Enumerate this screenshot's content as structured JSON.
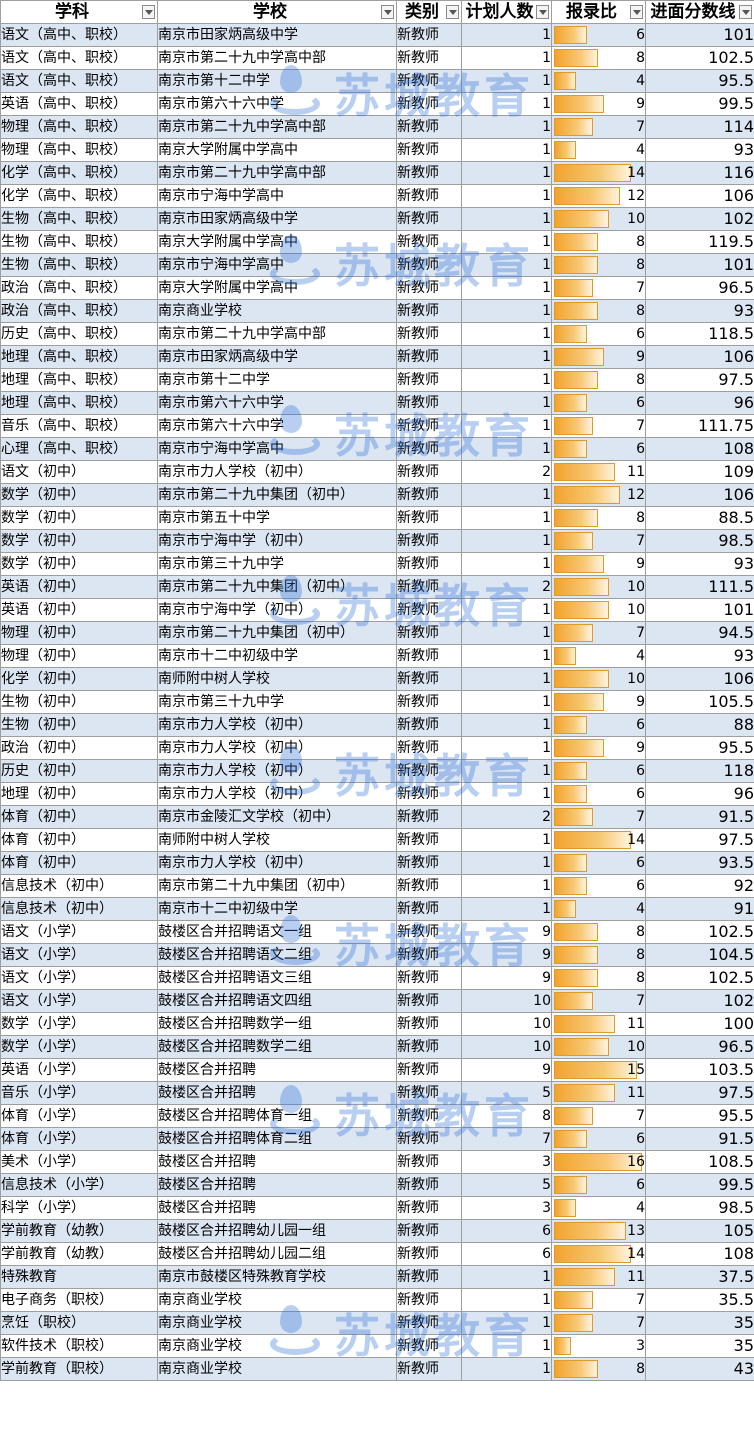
{
  "headers": {
    "subject": "学科",
    "school": "学校",
    "category": "类别",
    "plan": "计划人数",
    "ratio": "报录比",
    "score": "进面分数线"
  },
  "watermark": {
    "text": "苏城教育",
    "color": "#2a6fd6",
    "icon": "water-drop-logo-icon"
  },
  "ratio_max": 16,
  "rows": [
    [
      "语文（高中、职校）",
      "南京市田家炳高级中学",
      "新教师",
      "1",
      "6",
      "101"
    ],
    [
      "语文（高中、职校）",
      "南京市第二十九中学高中部",
      "新教师",
      "1",
      "8",
      "102.5"
    ],
    [
      "语文（高中、职校）",
      "南京市第十二中学",
      "新教师",
      "1",
      "4",
      "95.5"
    ],
    [
      "英语（高中、职校）",
      "南京市第六十六中学",
      "新教师",
      "1",
      "9",
      "99.5"
    ],
    [
      "物理（高中、职校）",
      "南京市第二十九中学高中部",
      "新教师",
      "1",
      "7",
      "114"
    ],
    [
      "物理（高中、职校）",
      "南京大学附属中学高中",
      "新教师",
      "1",
      "4",
      "93"
    ],
    [
      "化学（高中、职校）",
      "南京市第二十九中学高中部",
      "新教师",
      "1",
      "14",
      "116"
    ],
    [
      "化学（高中、职校）",
      "南京市宁海中学高中",
      "新教师",
      "1",
      "12",
      "106"
    ],
    [
      "生物（高中、职校）",
      "南京市田家炳高级中学",
      "新教师",
      "1",
      "10",
      "102"
    ],
    [
      "生物（高中、职校）",
      "南京大学附属中学高中",
      "新教师",
      "1",
      "8",
      "119.5"
    ],
    [
      "生物（高中、职校）",
      "南京市宁海中学高中",
      "新教师",
      "1",
      "8",
      "101"
    ],
    [
      "政治（高中、职校）",
      "南京大学附属中学高中",
      "新教师",
      "1",
      "7",
      "96.5"
    ],
    [
      "政治（高中、职校）",
      "南京商业学校",
      "新教师",
      "1",
      "8",
      "93"
    ],
    [
      "历史（高中、职校）",
      "南京市第二十九中学高中部",
      "新教师",
      "1",
      "6",
      "118.5"
    ],
    [
      "地理（高中、职校）",
      "南京市田家炳高级中学",
      "新教师",
      "1",
      "9",
      "106"
    ],
    [
      "地理（高中、职校）",
      "南京市第十二中学",
      "新教师",
      "1",
      "8",
      "97.5"
    ],
    [
      "地理（高中、职校）",
      "南京市第六十六中学",
      "新教师",
      "1",
      "6",
      "96"
    ],
    [
      "音乐（高中、职校）",
      "南京市第六十六中学",
      "新教师",
      "1",
      "7",
      "111.75"
    ],
    [
      "心理（高中、职校）",
      "南京市宁海中学高中",
      "新教师",
      "1",
      "6",
      "108"
    ],
    [
      "语文（初中）",
      "南京市力人学校（初中）",
      "新教师",
      "2",
      "11",
      "109"
    ],
    [
      "数学（初中）",
      "南京市第二十九中集团（初中）",
      "新教师",
      "1",
      "12",
      "106"
    ],
    [
      "数学（初中）",
      "南京市第五十中学",
      "新教师",
      "1",
      "8",
      "88.5"
    ],
    [
      "数学（初中）",
      "南京市宁海中学（初中）",
      "新教师",
      "1",
      "7",
      "98.5"
    ],
    [
      "数学（初中）",
      "南京市第三十九中学",
      "新教师",
      "1",
      "9",
      "93"
    ],
    [
      "英语（初中）",
      "南京市第二十九中集团（初中）",
      "新教师",
      "2",
      "10",
      "111.5"
    ],
    [
      "英语（初中）",
      "南京市宁海中学（初中）",
      "新教师",
      "1",
      "10",
      "101"
    ],
    [
      "物理（初中）",
      "南京市第二十九中集团（初中）",
      "新教师",
      "1",
      "7",
      "94.5"
    ],
    [
      "物理（初中）",
      "南京市十二中初级中学",
      "新教师",
      "1",
      "4",
      "93"
    ],
    [
      "化学（初中）",
      "南师附中树人学校",
      "新教师",
      "1",
      "10",
      "106"
    ],
    [
      "生物（初中）",
      "南京市第三十九中学",
      "新教师",
      "1",
      "9",
      "105.5"
    ],
    [
      "生物（初中）",
      "南京市力人学校（初中）",
      "新教师",
      "1",
      "6",
      "88"
    ],
    [
      "政治（初中）",
      "南京市力人学校（初中）",
      "新教师",
      "1",
      "9",
      "95.5"
    ],
    [
      "历史（初中）",
      "南京市力人学校（初中）",
      "新教师",
      "1",
      "6",
      "118"
    ],
    [
      "地理（初中）",
      "南京市力人学校（初中）",
      "新教师",
      "1",
      "6",
      "96"
    ],
    [
      "体育（初中）",
      "南京市金陵汇文学校（初中）",
      "新教师",
      "2",
      "7",
      "91.5"
    ],
    [
      "体育（初中）",
      "南师附中树人学校",
      "新教师",
      "1",
      "14",
      "97.5"
    ],
    [
      "体育（初中）",
      "南京市力人学校（初中）",
      "新教师",
      "1",
      "6",
      "93.5"
    ],
    [
      "信息技术（初中）",
      "南京市第二十九中集团（初中）",
      "新教师",
      "1",
      "6",
      "92"
    ],
    [
      "信息技术（初中）",
      "南京市十二中初级中学",
      "新教师",
      "1",
      "4",
      "91"
    ],
    [
      "语文（小学）",
      "鼓楼区合并招聘语文一组",
      "新教师",
      "9",
      "8",
      "102.5"
    ],
    [
      "语文（小学）",
      "鼓楼区合并招聘语文二组",
      "新教师",
      "9",
      "8",
      "104.5"
    ],
    [
      "语文（小学）",
      "鼓楼区合并招聘语文三组",
      "新教师",
      "9",
      "8",
      "102.5"
    ],
    [
      "语文（小学）",
      "鼓楼区合并招聘语文四组",
      "新教师",
      "10",
      "7",
      "102"
    ],
    [
      "数学（小学）",
      "鼓楼区合并招聘数学一组",
      "新教师",
      "10",
      "11",
      "100"
    ],
    [
      "数学（小学）",
      "鼓楼区合并招聘数学二组",
      "新教师",
      "10",
      "10",
      "96.5"
    ],
    [
      "英语（小学）",
      "鼓楼区合并招聘",
      "新教师",
      "9",
      "15",
      "103.5"
    ],
    [
      "音乐（小学）",
      "鼓楼区合并招聘",
      "新教师",
      "5",
      "11",
      "97.5"
    ],
    [
      "体育（小学）",
      "鼓楼区合并招聘体育一组",
      "新教师",
      "8",
      "7",
      "95.5"
    ],
    [
      "体育（小学）",
      "鼓楼区合并招聘体育二组",
      "新教师",
      "7",
      "6",
      "91.5"
    ],
    [
      "美术（小学）",
      "鼓楼区合并招聘",
      "新教师",
      "3",
      "16",
      "108.5"
    ],
    [
      "信息技术（小学）",
      "鼓楼区合并招聘",
      "新教师",
      "5",
      "6",
      "99.5"
    ],
    [
      "科学（小学）",
      "鼓楼区合并招聘",
      "新教师",
      "3",
      "4",
      "98.5"
    ],
    [
      "学前教育（幼教）",
      "鼓楼区合并招聘幼儿园一组",
      "新教师",
      "6",
      "13",
      "105"
    ],
    [
      "学前教育（幼教）",
      "鼓楼区合并招聘幼儿园二组",
      "新教师",
      "6",
      "14",
      "108"
    ],
    [
      "特殊教育",
      "南京市鼓楼区特殊教育学校",
      "新教师",
      "1",
      "11",
      "37.5"
    ],
    [
      "电子商务（职校）",
      "南京商业学校",
      "新教师",
      "1",
      "7",
      "35.5"
    ],
    [
      "烹饪（职校）",
      "南京商业学校",
      "新教师",
      "1",
      "7",
      "35"
    ],
    [
      "软件技术（职校）",
      "南京商业学校",
      "新教师",
      "1",
      "3",
      "35"
    ],
    [
      "学前教育（职校）",
      "南京商业学校",
      "新教师",
      "1",
      "8",
      "43"
    ]
  ]
}
